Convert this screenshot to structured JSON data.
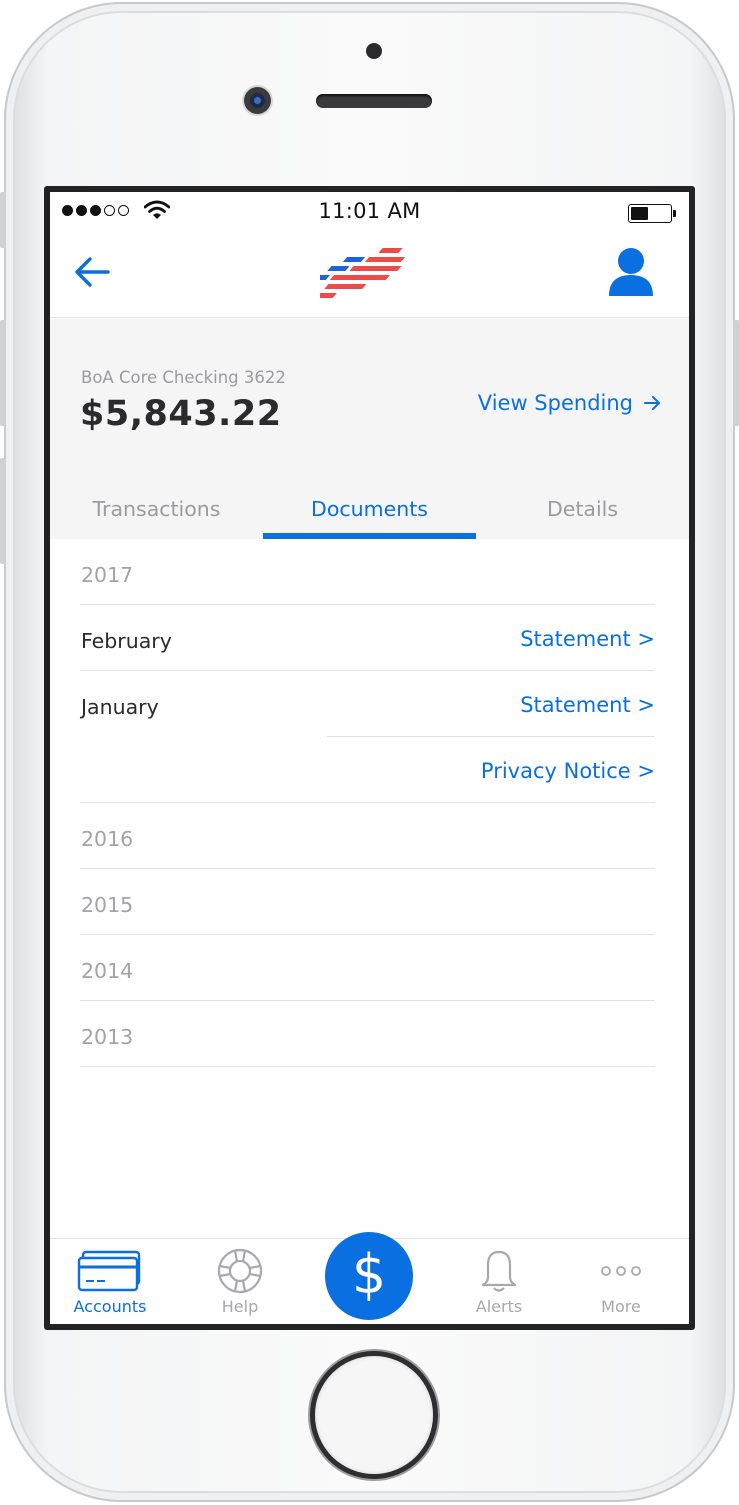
{
  "status_bar": {
    "signal_bars": 3,
    "signal_total": 5,
    "time": "11:01 AM",
    "battery_level": 0.45
  },
  "nav": {
    "back_icon": "arrow-left-icon",
    "logo": "bank-flag-logo",
    "profile_icon": "person-icon",
    "logo_colors": {
      "blue": "#1f62e0",
      "red": "#ee4b48"
    }
  },
  "account": {
    "name": "BoA Core Checking 3622",
    "balance": "$5,843.22",
    "view_spending": "View Spending"
  },
  "tabs": [
    {
      "label": "Transactions",
      "active": false
    },
    {
      "label": "Documents",
      "active": true
    },
    {
      "label": "Details",
      "active": false
    }
  ],
  "documents": {
    "year_2017": "2017",
    "feb": {
      "month": "February",
      "link": "Statement >"
    },
    "jan": {
      "month": "January",
      "link": "Statement >"
    },
    "jan_extra": {
      "link": "Privacy Notice >"
    },
    "other_years": [
      "2016",
      "2015",
      "2014",
      "2013"
    ]
  },
  "tab_bar": {
    "items": [
      {
        "label": "Accounts",
        "icon": "credit-card-icon",
        "active": true
      },
      {
        "label": "Help",
        "icon": "lifebuoy-icon",
        "active": false
      },
      {
        "label": "Alerts",
        "icon": "bell-icon",
        "active": false
      },
      {
        "label": "More",
        "icon": "more-dots-icon",
        "active": false
      }
    ],
    "pay_button": {
      "symbol": "$",
      "icon": "dollar-icon"
    }
  },
  "colors": {
    "accent": "#0a6fe0",
    "muted_text": "#9b9ba0",
    "header_bg": "#f5f5f6"
  }
}
